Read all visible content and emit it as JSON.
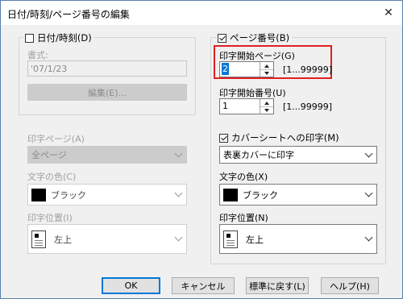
{
  "window": {
    "title": "日付/時刻/ページ番号の編集",
    "close_glyph": "✕"
  },
  "date_group": {
    "legend": "日付/時刻(D)",
    "format_label": "書式:",
    "format_value": "'07/1/23",
    "edit_button": "編集(E)..."
  },
  "page_group": {
    "legend": "ページ番号(B)",
    "start_page_label": "印字開始ページ(G)",
    "start_page_value": "2",
    "start_page_range": "[1...99999]",
    "start_number_label": "印字開始番号(U)",
    "start_number_value": "1",
    "start_number_range": "[1...99999]",
    "cover_checkbox": "カバーシートへの印字(M)",
    "cover_select": "表裏カバーに印字",
    "color_label": "文字の色(X)",
    "color_value": "ブラック",
    "position_label": "印字位置(N)",
    "position_value": "左上"
  },
  "left_bottom": {
    "print_page_label": "印字ページ(A)",
    "print_page_value": "全ページ",
    "color_label": "文字の色(C)",
    "color_value": "ブラック",
    "position_label": "印字位置(I)",
    "position_value": "左上"
  },
  "buttons": {
    "ok": "OK",
    "cancel": "キャンセル",
    "default": "標準に戻す(L)",
    "help": "ヘルプ(H)"
  },
  "colors": {
    "highlight": "#e02020",
    "selection": "#0078d7",
    "swatch": "#000000"
  },
  "icons": {
    "close": "close-icon",
    "position": "position-top-left-icon"
  }
}
